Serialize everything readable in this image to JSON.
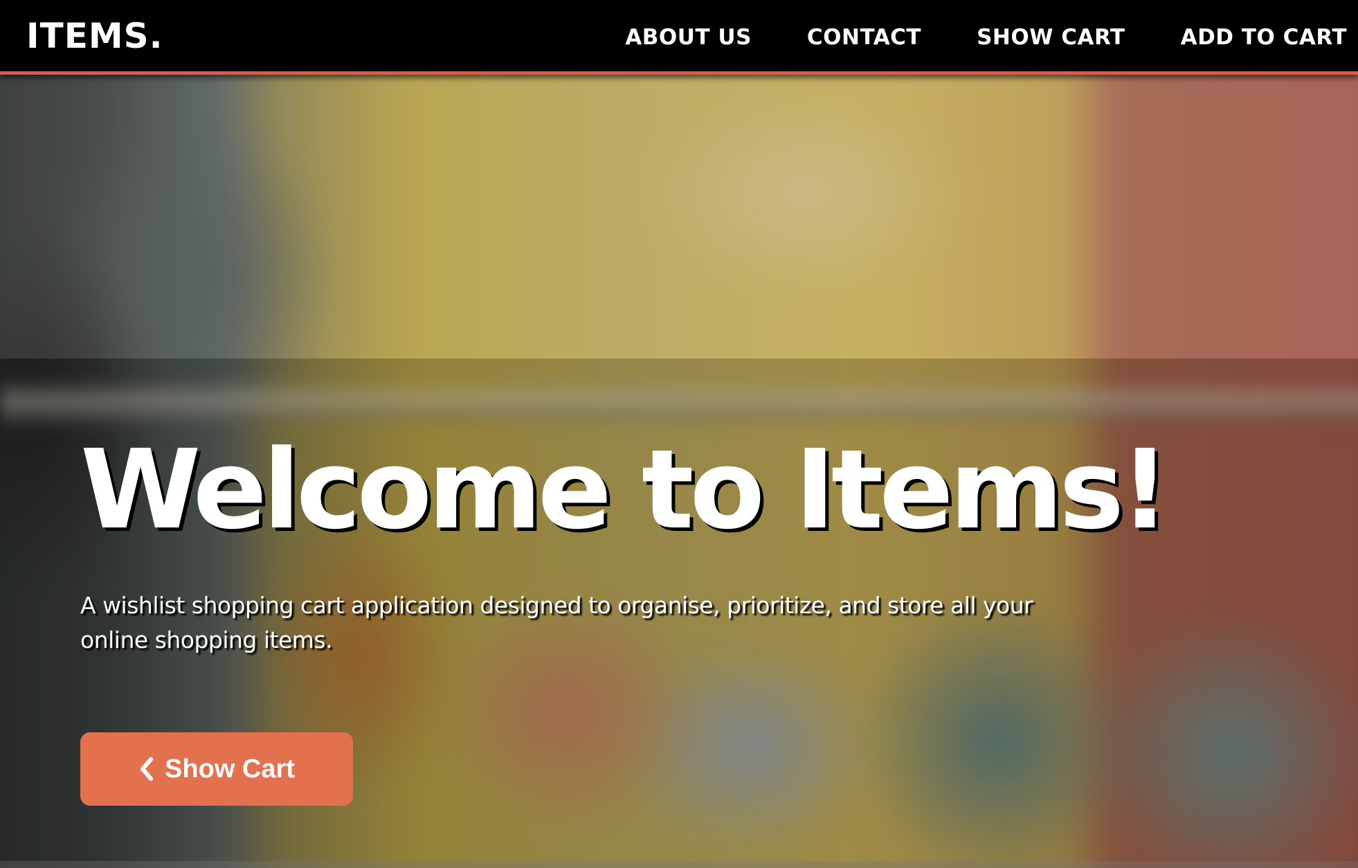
{
  "navbar": {
    "brand": "ITEMS.",
    "links": [
      {
        "label": "ABOUT US"
      },
      {
        "label": "CONTACT"
      },
      {
        "label": "SHOW CART"
      },
      {
        "label": "ADD TO CART"
      }
    ],
    "accent_color": "#e0574a"
  },
  "hero": {
    "title": "Welcome to Items!",
    "subtitle": "A wishlist shopping cart application designed to organise, prioritize, and store all your online shopping items.",
    "cta": {
      "label": "Show Cart",
      "icon": "chevron-left-icon",
      "color": "#e4714d"
    }
  }
}
